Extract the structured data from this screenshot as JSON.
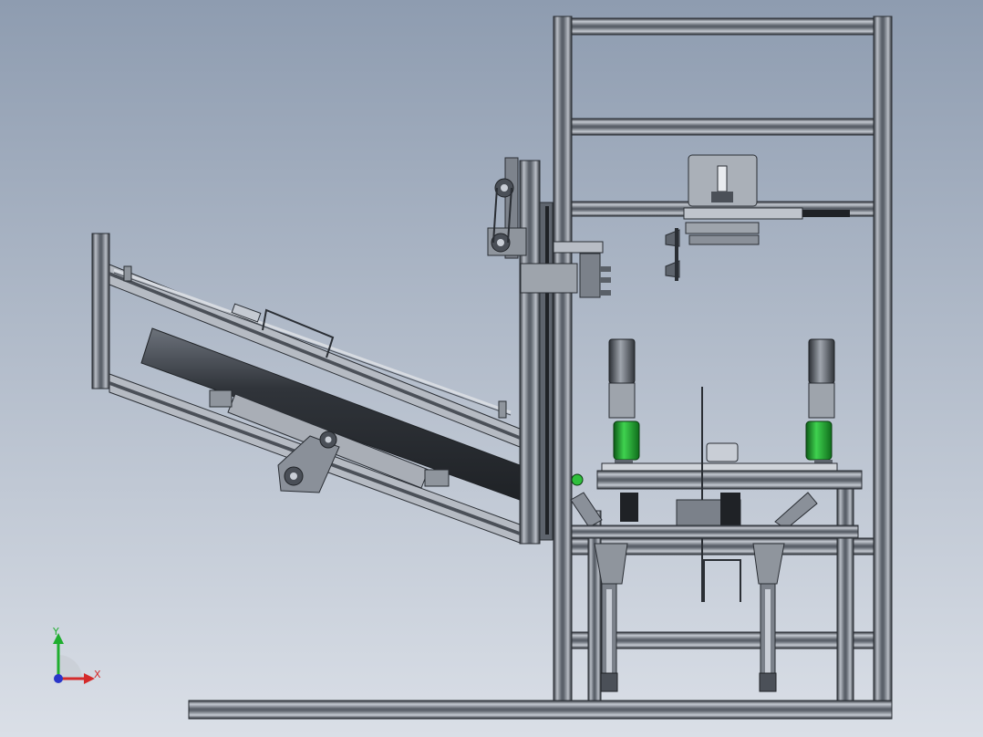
{
  "triad": {
    "x_label": "X",
    "y_label": "Y"
  },
  "colors": {
    "background_top": "#8e9cb0",
    "background_bottom": "#d9dee6",
    "profile_dark": "#3a3f47",
    "profile_mid": "#8a9099",
    "profile_light": "#c9ced6",
    "motor_green": "#1fae2f",
    "plate": "#9aa0a8",
    "axis_x": "#d42a2a",
    "axis_y": "#1fae2f",
    "axis_z": "#2a36c9"
  }
}
